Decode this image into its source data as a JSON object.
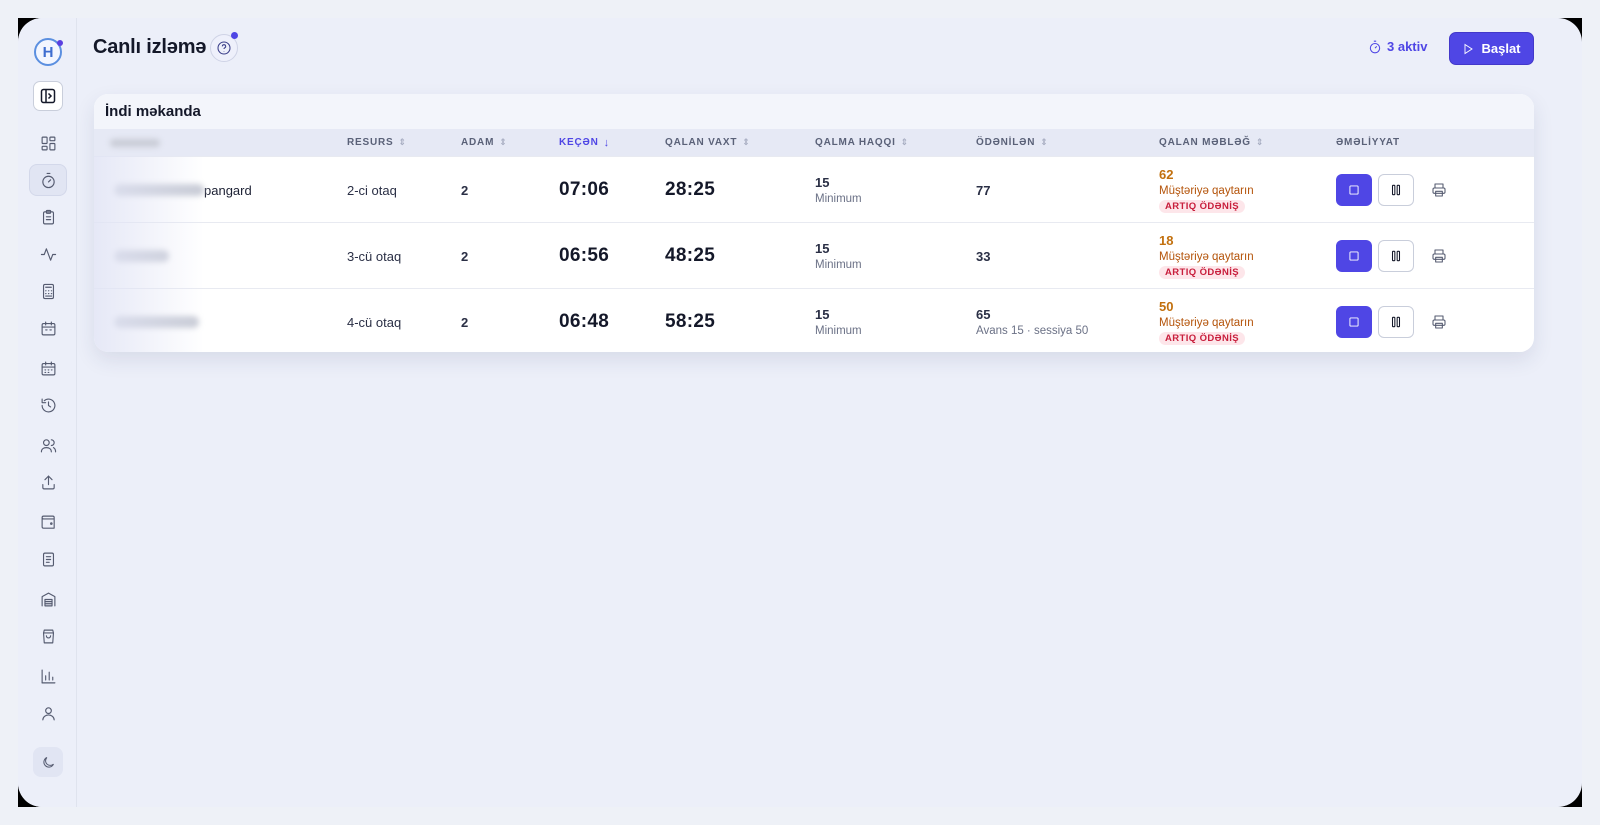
{
  "app": {
    "logo_letter": "H"
  },
  "header": {
    "title": "Canlı izləmə",
    "active_label": "3 aktiv",
    "start_label": "Başlat"
  },
  "colors": {
    "accent": "#4f46e5",
    "warning": "#c2700e",
    "danger": "#c81e3c",
    "background": "#eceff9"
  },
  "sidebar": {
    "items": [
      {
        "icon": "dashboard-icon"
      },
      {
        "icon": "timer-icon",
        "active": true
      },
      {
        "icon": "clipboard-icon"
      },
      {
        "icon": "activity-icon"
      },
      {
        "icon": "calculator-icon"
      },
      {
        "icon": "calendar-icon"
      },
      {
        "icon": "calendar-grid-icon"
      },
      {
        "icon": "history-icon"
      },
      {
        "icon": "users-icon"
      },
      {
        "icon": "upload-icon"
      },
      {
        "icon": "wallet-icon"
      },
      {
        "icon": "book-icon"
      },
      {
        "icon": "warehouse-icon"
      },
      {
        "icon": "shopping-bag-icon"
      },
      {
        "icon": "bar-chart-icon"
      },
      {
        "icon": "user-icon"
      }
    ],
    "theme_icon": "moon-icon"
  },
  "card": {
    "title": "İndi məkanda",
    "columns": {
      "resource": "RESURS",
      "people": "ADAM",
      "elapsed": "KEÇƏN",
      "remaining_time": "QALAN VAXT",
      "stay_fee": "QALMA HAQQI",
      "paid": "ÖDƏNİLƏN",
      "remaining_amount": "QALAN MƏBLƏĞ",
      "actions": "ƏMƏLİYYAT"
    },
    "rows": [
      {
        "name_suffix": "pangard",
        "resource": "2-ci otaq",
        "people": "2",
        "elapsed": "07:06",
        "remaining_time": "28:25",
        "fee": "15",
        "fee_sub": "Minimum",
        "paid": "77",
        "paid_sub": "",
        "remaining_amount": "62",
        "refund": "Müştəriyə qaytarın",
        "badge": "ARTIQ ÖDƏNİŞ"
      },
      {
        "name_suffix": "",
        "resource": "3-cü otaq",
        "people": "2",
        "elapsed": "06:56",
        "remaining_time": "48:25",
        "fee": "15",
        "fee_sub": "Minimum",
        "paid": "33",
        "paid_sub": "",
        "remaining_amount": "18",
        "refund": "Müştəriyə qaytarın",
        "badge": "ARTIQ ÖDƏNİŞ"
      },
      {
        "name_suffix": "",
        "resource": "4-cü otaq",
        "people": "2",
        "elapsed": "06:48",
        "remaining_time": "58:25",
        "fee": "15",
        "fee_sub": "Minimum",
        "paid": "65",
        "paid_sub": "Avans 15 · sessiya 50",
        "remaining_amount": "50",
        "refund": "Müştəriyə qaytarın",
        "badge": "ARTIQ ÖDƏNİŞ"
      }
    ]
  }
}
